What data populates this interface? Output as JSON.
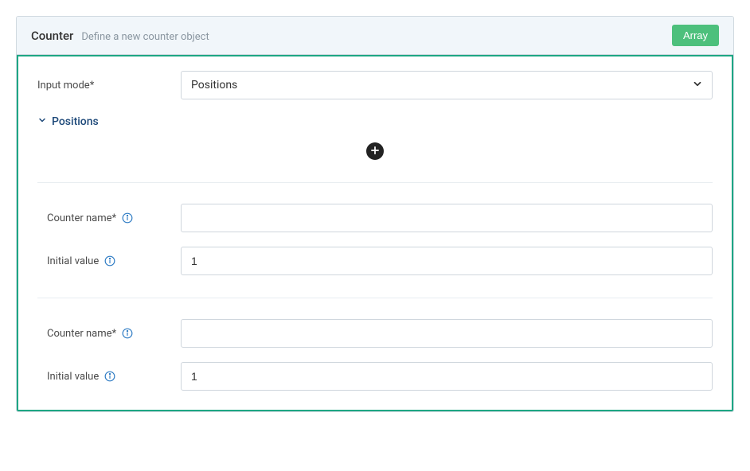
{
  "header": {
    "title": "Counter",
    "subtitle": "Define a new counter object",
    "array_button": "Array"
  },
  "form": {
    "input_mode_label": "Input mode",
    "input_mode_value": "Positions",
    "positions_toggle": "Positions"
  },
  "blocks": [
    {
      "counter_name_label": "Counter name",
      "counter_name_value": "",
      "initial_value_label": "Initial value",
      "initial_value_value": "1"
    },
    {
      "counter_name_label": "Counter name",
      "counter_name_value": "",
      "initial_value_label": "Initial value",
      "initial_value_value": "1"
    }
  ]
}
